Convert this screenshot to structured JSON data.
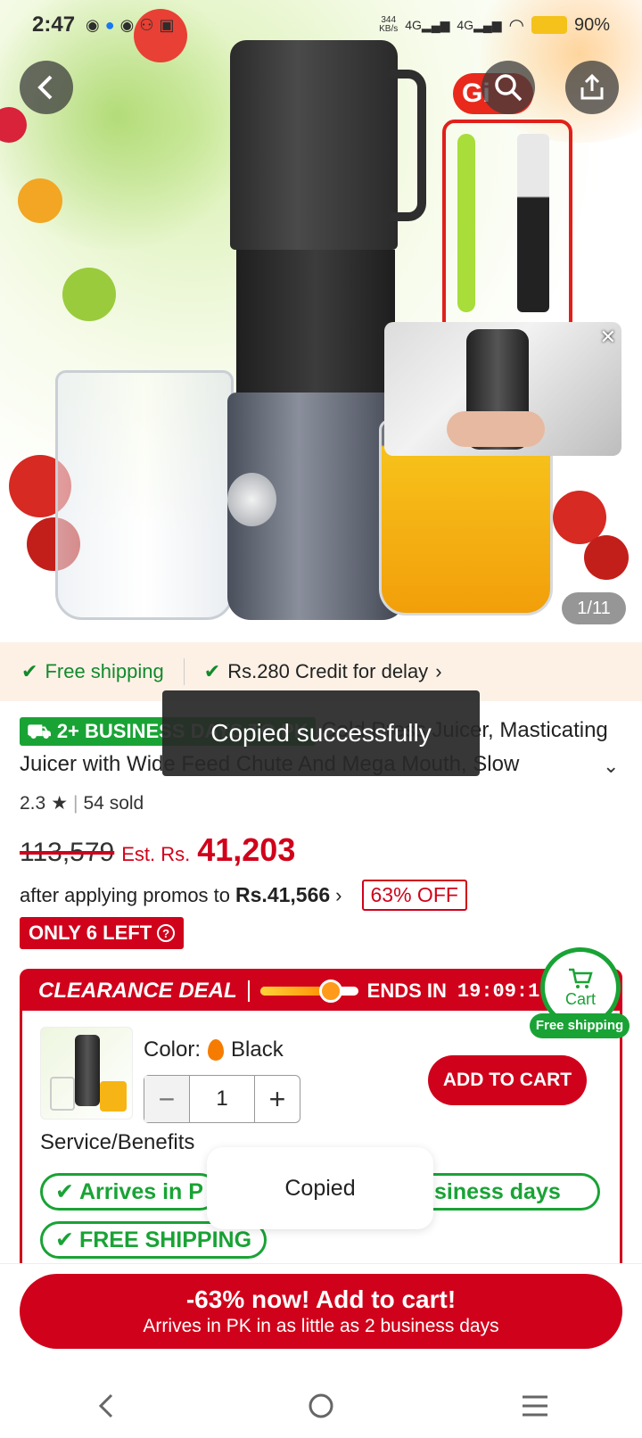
{
  "status_bar": {
    "time": "2:47",
    "net_speed": "344\nKB/s",
    "net_type_1": "4G",
    "net_type_2": "4G",
    "battery": "90%"
  },
  "gallery": {
    "counter": "1/11",
    "gift_tag": "Gi"
  },
  "shipping": {
    "free_shipping": "Free shipping",
    "credit": "Rs.280 Credit for delay"
  },
  "product": {
    "badge": "2+ BUSINESS DAYS TO PK",
    "title": "Cold Press Juicer, Masticating Juicer with Wide Feed Chute And Mega Mouth, Slow",
    "rating": "2.3",
    "sold": "54 sold",
    "original_price": "113,579",
    "est_label": "Est. Rs.",
    "est_price": "41,203",
    "promo_text": "after applying promos to",
    "promo_price": "Rs.41,566",
    "discount": "63% OFF",
    "stock_badge": "ONLY 6 LEFT"
  },
  "clearance": {
    "title": "CLEARANCE DEAL",
    "ends_label": "ENDS IN",
    "time": "19:09:1",
    "progress": 0.72,
    "color_label": "Color:",
    "color_value": "Black",
    "quantity": "1",
    "add_to_cart": "ADD TO CART",
    "service_label": "Service/Benefits",
    "pill_arrives_start": "Arrives in P",
    "pill_arrives_end": "siness days",
    "pill_free_shipping": "FREE SHIPPING"
  },
  "cart_float": {
    "label": "Cart",
    "free_shipping": "Free shipping"
  },
  "toasts": {
    "copied_successfully": "Copied successfully",
    "copied": "Copied"
  },
  "cta": {
    "main": "-63% now! Add to cart!",
    "sub": "Arrives in PK in as little as 2 business days"
  },
  "colors": {
    "accent_red": "#d0021b",
    "accent_green": "#19a335"
  }
}
